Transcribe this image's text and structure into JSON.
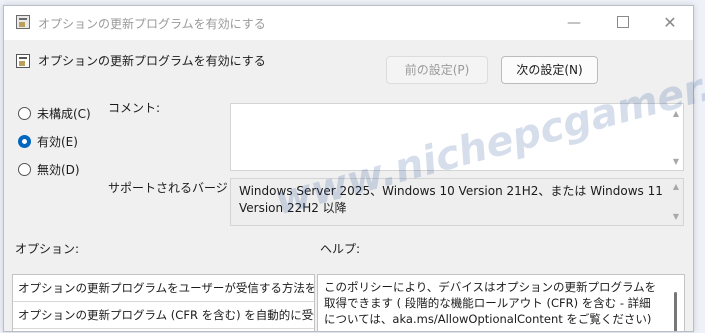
{
  "window": {
    "title": "オプションの更新プログラムを有効にする",
    "controls": {
      "minimize": "—",
      "maximize": "",
      "close": "✕"
    }
  },
  "header": {
    "policy_title": "オプションの更新プログラムを有効にする",
    "prev_button": "前の設定(P)",
    "next_button": "次の設定(N)"
  },
  "state_options": [
    {
      "label": "未構成(C)",
      "checked": false
    },
    {
      "label": "有効(E)",
      "checked": true
    },
    {
      "label": "無効(D)",
      "checked": false
    }
  ],
  "comment": {
    "label": "コメント:",
    "value": ""
  },
  "supported": {
    "label": "サポートされるバージョン:",
    "value": "Windows Server 2025、Windows 10 Version 21H2、または Windows 11 Version 22H2 以降"
  },
  "options": {
    "label": "オプション:",
    "rows": [
      "オプションの更新プログラムをユーザーが受信する方法を選択す",
      "オプションの更新プログラム (CFR を含む) を自動的に受信する"
    ]
  },
  "help": {
    "label": "ヘルプ:",
    "text": "このポリシーにより、デバイスはオプションの更新プログラムを取得できます ( 段階的な機能ロールアウト (CFR) を含む - 詳細については、aka.ms/AllowOptionalContent をご覧ください)"
  },
  "watermark": "www.nichepcgamer.com"
}
